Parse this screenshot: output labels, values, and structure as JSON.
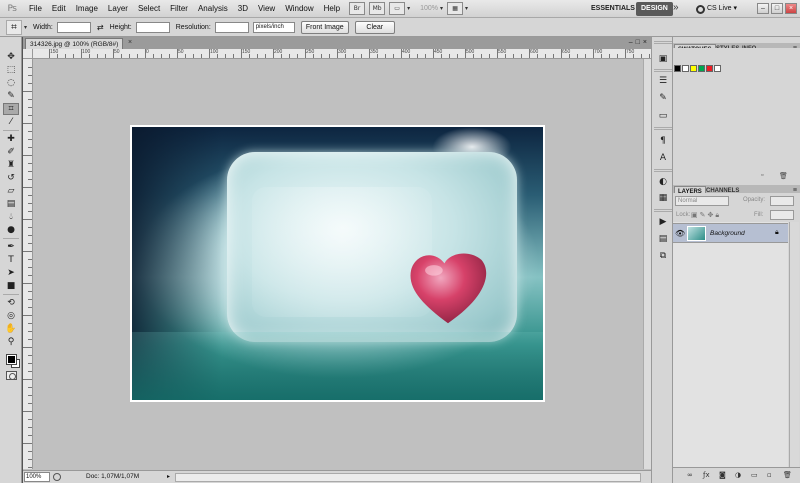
{
  "app": {
    "logo": "Ps",
    "menus": [
      "File",
      "Edit",
      "Image",
      "Layer",
      "Select",
      "Filter",
      "Analysis",
      "3D",
      "View",
      "Window",
      "Help"
    ],
    "menubar_icons": [
      {
        "name": "bridge-icon",
        "glyph": "Br"
      },
      {
        "name": "minibridge-icon",
        "glyph": "Mb"
      },
      {
        "name": "arrange-documents-icon",
        "glyph": "▭"
      },
      {
        "name": "screen-mode-icon",
        "glyph": "▦"
      }
    ],
    "zoom_readout": "100%",
    "workspace": {
      "essentials": "ESSENTIALS",
      "design": "DESIGN",
      "more": "»"
    },
    "cs_live": "CS Live"
  },
  "options_bar": {
    "width_label": "Width:",
    "height_label": "Height:",
    "resolution_label": "Resolution:",
    "width_value": "",
    "height_value": "",
    "resolution_value": "",
    "resolution_unit": "pixels/inch",
    "swap_glyph": "⇄",
    "front_image_label": "Front Image",
    "clear_label": "Clear"
  },
  "document": {
    "tab_title": "314326.jpg @ 100% (RGB/8#)",
    "tab_close": "×",
    "ruler_top_labels": [
      "150",
      "100",
      "50",
      "0",
      "50",
      "100",
      "150",
      "200",
      "250",
      "300",
      "350",
      "400",
      "450",
      "500",
      "550",
      "600",
      "650",
      "700",
      "750"
    ],
    "status_zoom": "100%",
    "status_doc": "Doc: 1,07M/1,07M",
    "status_arrow": "▸"
  },
  "panels": {
    "swatches_tabs": [
      "SWATCHES",
      "STYLES",
      "INFO"
    ],
    "swatch_colors": [
      "#000000",
      "#ffffff",
      "#ffff00",
      "#00a651",
      "#ed1c24",
      "#ffffff"
    ],
    "layers_tabs": [
      "LAYERS",
      "CHANNELS"
    ],
    "blend_mode": "Normal",
    "opacity_label": "Opacity:",
    "lock_label": "Lock:",
    "fill_label": "Fill:",
    "layer_name": "Background"
  }
}
